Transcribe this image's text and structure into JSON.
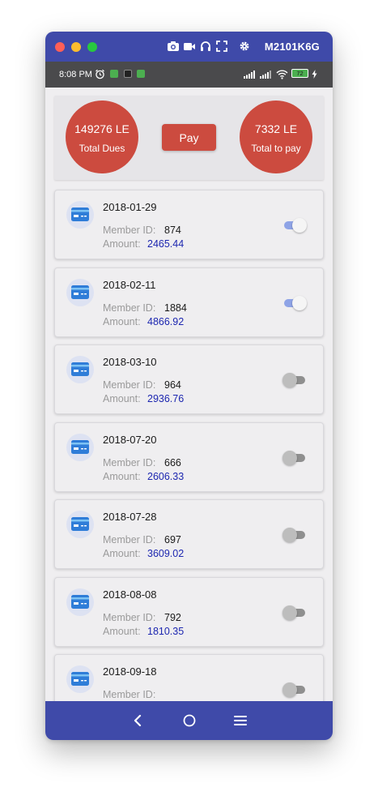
{
  "window": {
    "device_name": "M2101K6G"
  },
  "status_bar": {
    "time": "8:08 PM",
    "battery": "72"
  },
  "summary": {
    "total_dues_amount": "149276 LE",
    "total_dues_label": "Total Dues",
    "pay_label": "Pay",
    "total_to_pay_amount": "7332 LE",
    "total_to_pay_label": "Total to pay"
  },
  "labels": {
    "member_id": "Member ID:",
    "amount": "Amount:"
  },
  "payments": [
    {
      "date": "2018-01-29",
      "member_id": "874",
      "amount": "2465.44",
      "selected": true
    },
    {
      "date": "2018-02-11",
      "member_id": "1884",
      "amount": "4866.92",
      "selected": true
    },
    {
      "date": "2018-03-10",
      "member_id": "964",
      "amount": "2936.76",
      "selected": false
    },
    {
      "date": "2018-07-20",
      "member_id": "666",
      "amount": "2606.33",
      "selected": false
    },
    {
      "date": "2018-07-28",
      "member_id": "697",
      "amount": "3609.02",
      "selected": false
    },
    {
      "date": "2018-08-08",
      "member_id": "792",
      "amount": "1810.35",
      "selected": false
    },
    {
      "date": "2018-09-18",
      "member_id": "",
      "amount": "",
      "selected": false
    }
  ],
  "icons": {
    "card": "credit-card-icon",
    "camera": "camera-icon",
    "video": "video-icon",
    "audio": "headphones-icon",
    "fullscreen": "fullscreen-icon",
    "settings": "gear-icon",
    "back": "back-icon",
    "home": "home-icon",
    "menu": "menu-icon"
  },
  "colors": {
    "accent": "#cc4b3f",
    "bar": "#3f4aa9",
    "amount_text": "#1d27b0",
    "switch_on": "#8ea3e6"
  }
}
